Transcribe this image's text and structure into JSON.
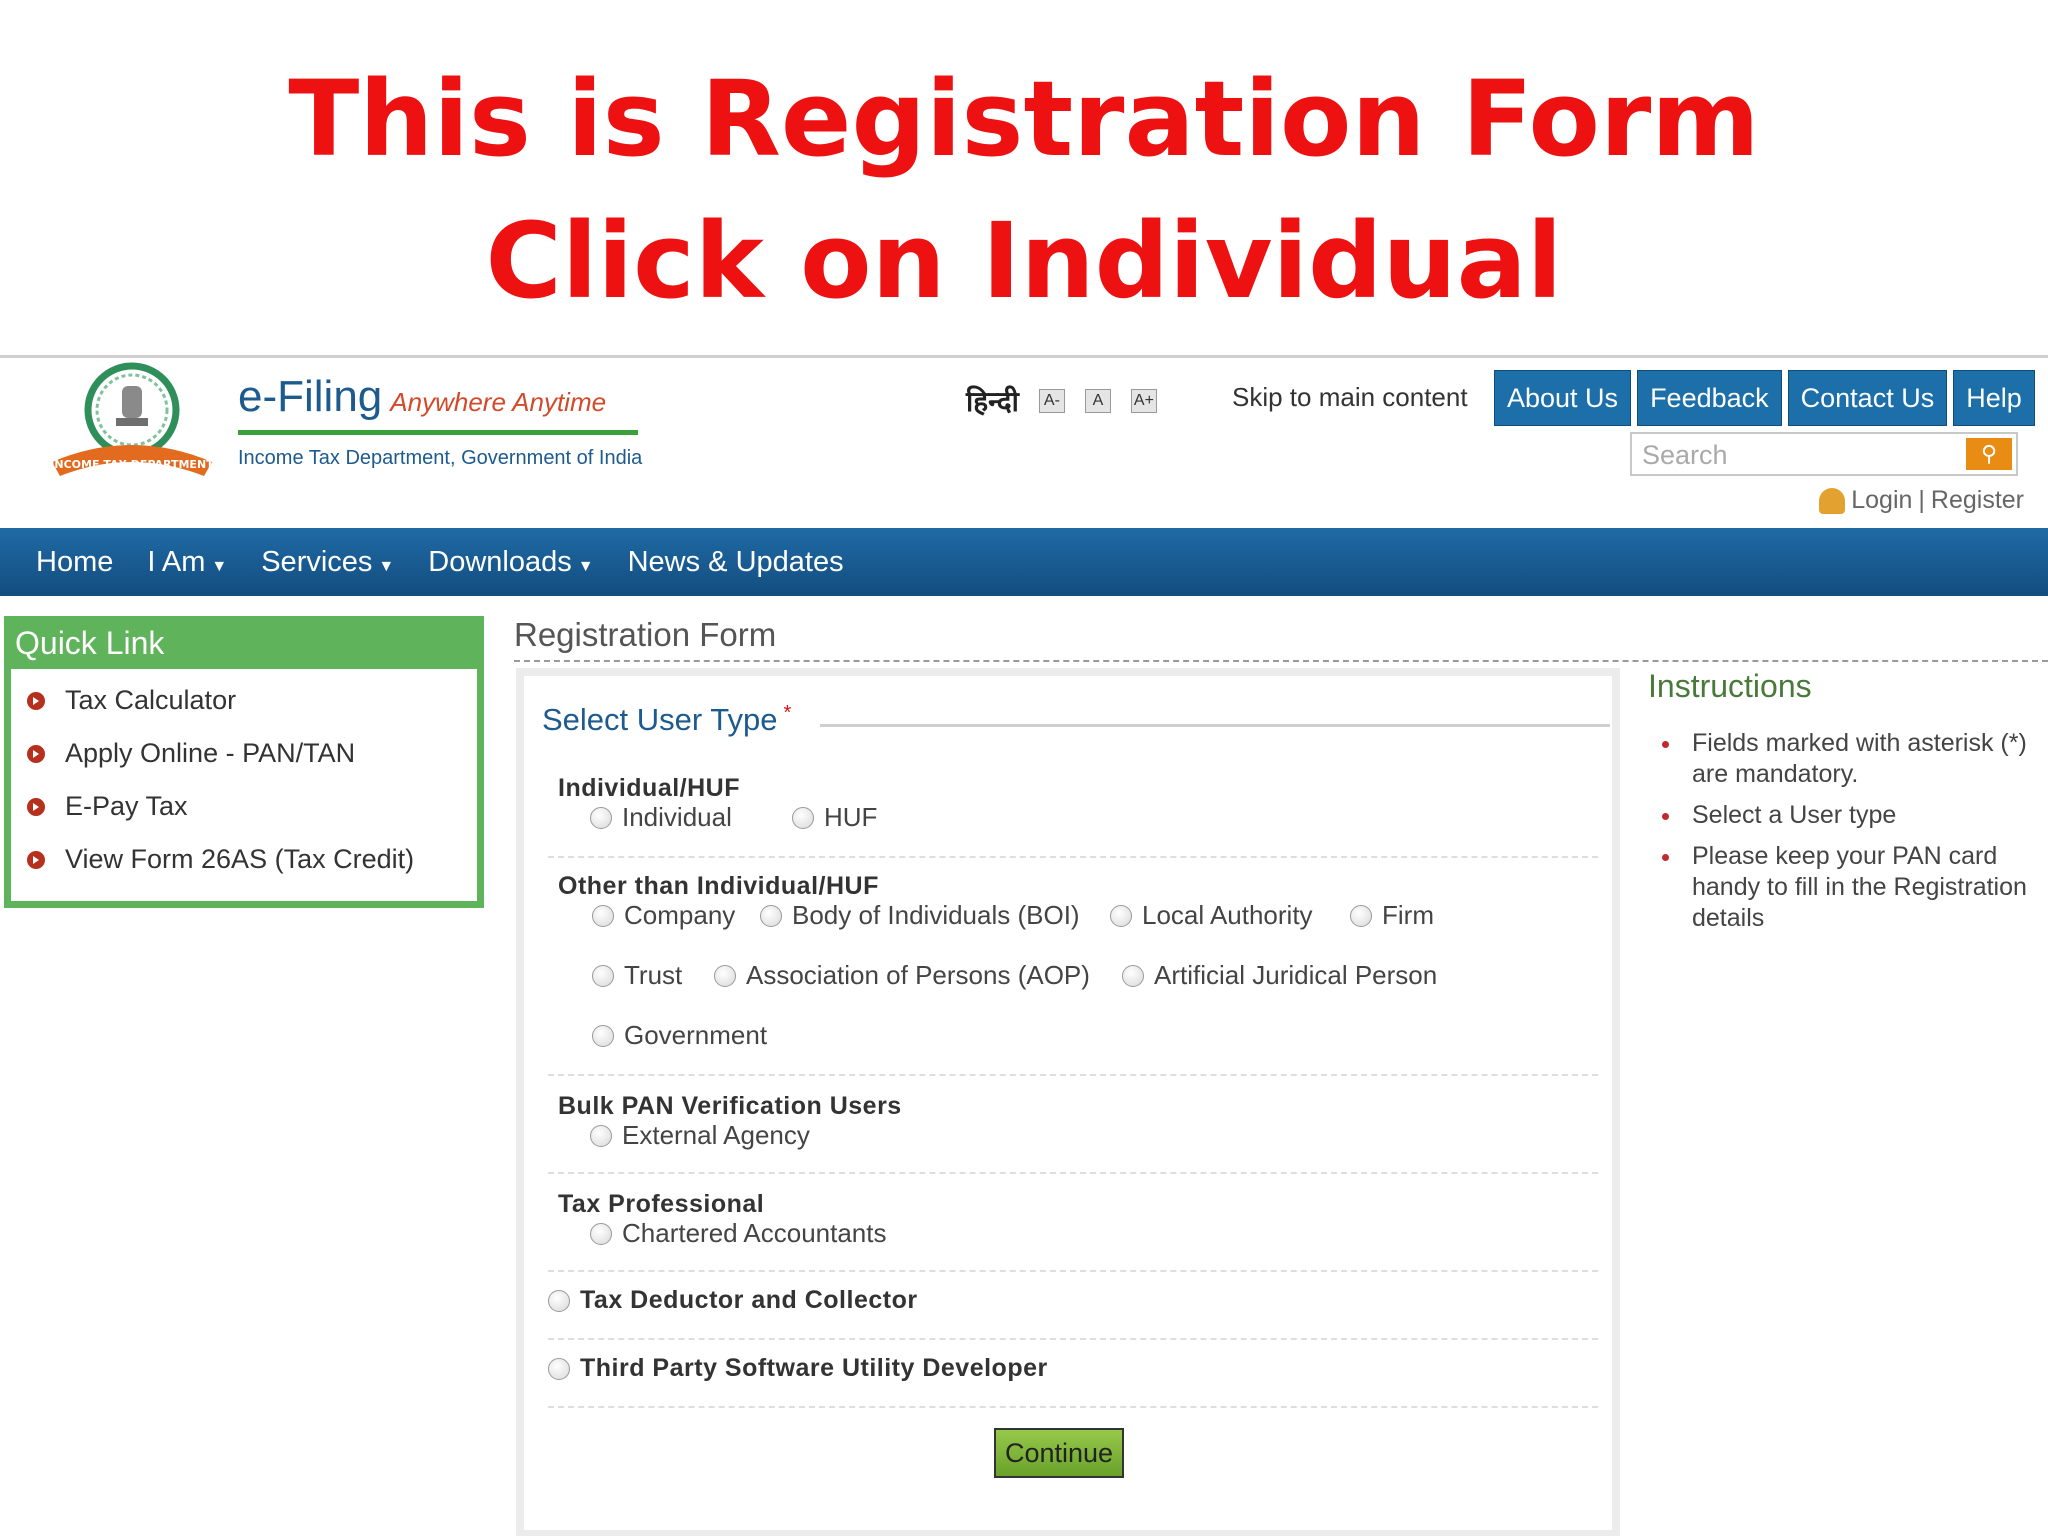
{
  "headline": {
    "line1": "This is Registration Form",
    "line2": "Click on Individual"
  },
  "header": {
    "brand_title": "e-Filing",
    "brand_tagline": "Anywhere Anytime",
    "brand_subtitle": "Income Tax Department, Government of India",
    "emblem_text": "INCOME TAX DEPARTMENT",
    "hindi_label": "हिन्दी",
    "font_sizes": [
      "A-",
      "A",
      "A+"
    ],
    "skip_link": "Skip to main content",
    "top_nav": [
      "About Us",
      "Feedback",
      "Contact Us",
      "Help"
    ],
    "search_placeholder": "Search",
    "login": "Login",
    "login_separator": "|",
    "register": "Register"
  },
  "main_nav": [
    {
      "label": "Home",
      "dropdown": false
    },
    {
      "label": "I Am",
      "dropdown": true
    },
    {
      "label": "Services",
      "dropdown": true
    },
    {
      "label": "Downloads",
      "dropdown": true
    },
    {
      "label": "News & Updates",
      "dropdown": false
    }
  ],
  "quick_link": {
    "title": "Quick Link",
    "items": [
      "Tax Calculator",
      "Apply Online - PAN/TAN",
      "E-Pay Tax",
      "View Form 26AS (Tax Credit)"
    ]
  },
  "form": {
    "title": "Registration Form",
    "select_user_type": "Select User Type",
    "required_marker": "*",
    "groups": {
      "individual": {
        "title": "Individual/HUF",
        "options": [
          "Individual",
          "HUF"
        ]
      },
      "other": {
        "title": "Other than Individual/HUF",
        "options": [
          "Company",
          "Body of Individuals (BOI)",
          "Local Authority",
          "Firm",
          "Trust",
          "Association of Persons (AOP)",
          "Artificial Juridical Person",
          "Government"
        ]
      },
      "bulk": {
        "title": "Bulk PAN Verification Users",
        "options": [
          "External Agency"
        ]
      },
      "tax_professional": {
        "title": "Tax Professional",
        "options": [
          "Chartered Accountants"
        ]
      },
      "deductor": {
        "title": "Tax Deductor and Collector"
      },
      "third_party": {
        "title": "Third Party Software Utility Developer"
      }
    },
    "continue_label": "Continue"
  },
  "instructions": {
    "title": "Instructions",
    "items": [
      "Fields marked with asterisk (*) are mandatory.",
      "Select a User type",
      "Please keep your PAN card handy to fill in the Registration details"
    ]
  }
}
